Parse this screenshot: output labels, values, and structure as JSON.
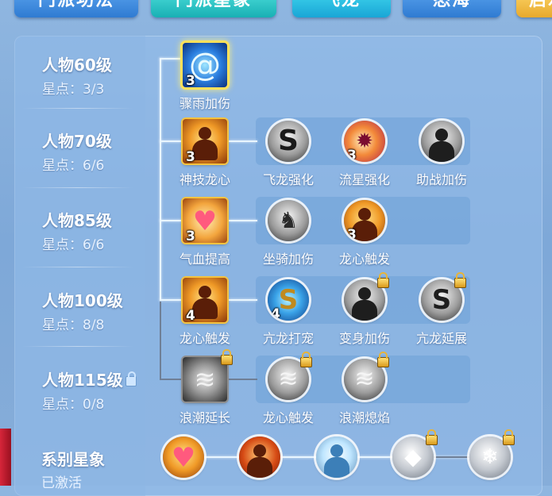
{
  "tabs": [
    {
      "label": "门派功法"
    },
    {
      "label": "门派星象"
    },
    {
      "label": "飞龙"
    },
    {
      "label": "怒海"
    },
    {
      "label": "启示"
    }
  ],
  "rows": [
    {
      "level": "人物60级",
      "stars": "星点：3/3",
      "locked": false
    },
    {
      "level": "人物70级",
      "stars": "星点：6/6",
      "locked": false
    },
    {
      "level": "人物85级",
      "stars": "星点：6/6",
      "locked": false
    },
    {
      "level": "人物100级",
      "stars": "星点：8/8",
      "locked": false
    },
    {
      "level": "人物115级",
      "stars": "星点：0/8",
      "locked": true
    }
  ],
  "skills": {
    "r1": {
      "name": "骤雨加伤",
      "count": "3"
    },
    "r2": [
      {
        "name": "神技龙心",
        "count": "3"
      },
      {
        "name": "飞龙强化",
        "count": ""
      },
      {
        "name": "流星强化",
        "count": "3"
      },
      {
        "name": "助战加伤",
        "count": ""
      }
    ],
    "r3": [
      {
        "name": "气血提高",
        "count": "3"
      },
      {
        "name": "坐骑加伤",
        "count": ""
      },
      {
        "name": "龙心触发",
        "count": "3"
      }
    ],
    "r4": [
      {
        "name": "龙心触发",
        "count": "4"
      },
      {
        "name": "亢龙打宠",
        "count": "4"
      },
      {
        "name": "变身加伤",
        "count": ""
      },
      {
        "name": "亢龙延展",
        "count": ""
      }
    ],
    "r5": [
      {
        "name": "浪潮延长",
        "count": ""
      },
      {
        "name": "龙心触发",
        "count": ""
      },
      {
        "name": "浪潮熄焰",
        "count": ""
      }
    ]
  },
  "series": {
    "title": "系别星象",
    "status": "已激活"
  },
  "icons": {
    "water": "water-swirl-icon",
    "fire_figure": "fire-figure-icon",
    "dragon": "dragon-icon",
    "meteor": "meteor-icon",
    "support": "support-figure-icon",
    "heart": "heart-icon",
    "mount": "mount-beast-icon",
    "wave": "wave-icon",
    "lock": "lock-icon"
  }
}
